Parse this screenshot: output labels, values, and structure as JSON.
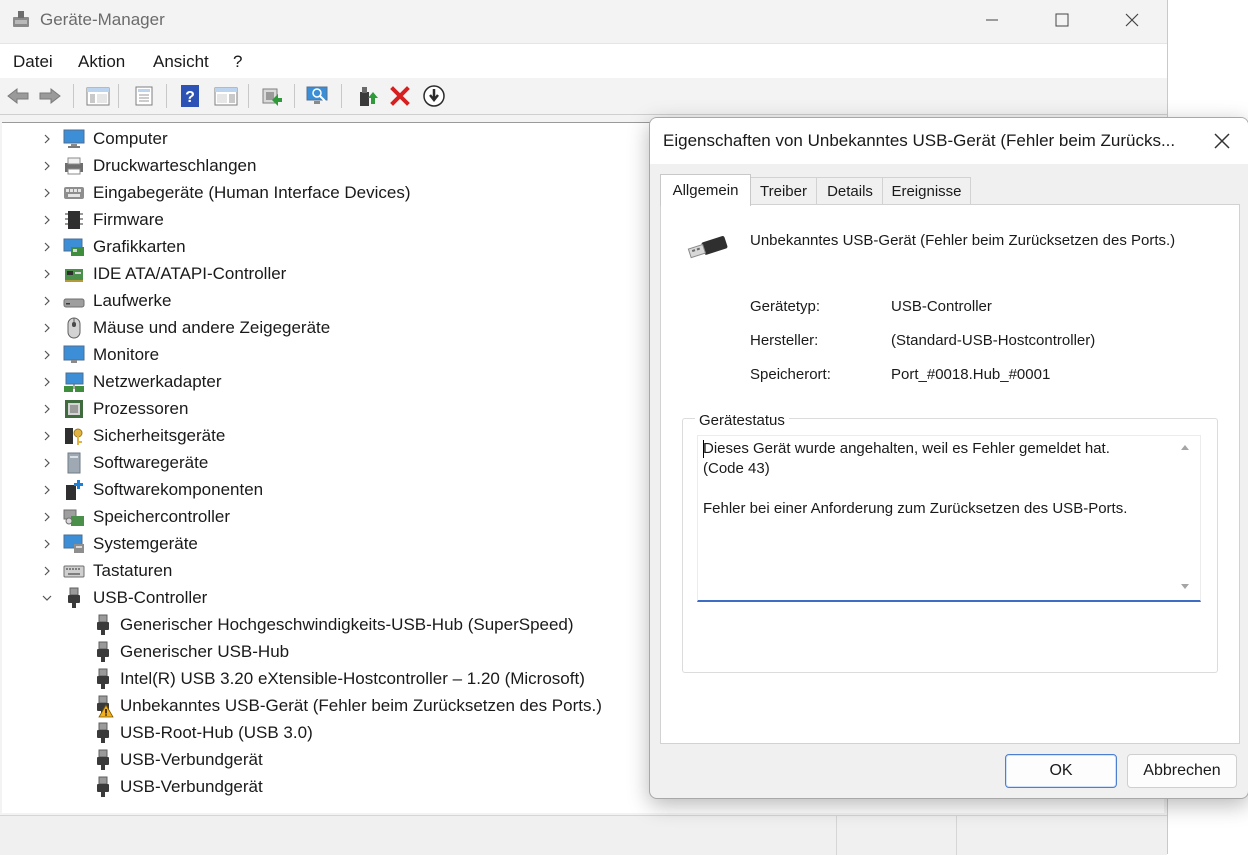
{
  "window": {
    "title": "Geräte-Manager"
  },
  "menu": [
    "Datei",
    "Aktion",
    "Ansicht",
    "?"
  ],
  "toolbar_icons": [
    "back-arrow-icon",
    "forward-arrow-icon",
    "show-hide-console-tree-icon",
    "properties-icon",
    "help-icon",
    "action-pane-icon",
    "update-driver-icon",
    "scan-hardware-icon",
    "enable-device-icon",
    "uninstall-device-icon",
    "disable-device-icon"
  ],
  "tree": {
    "categories": [
      {
        "label": "Computer",
        "icon": "computer-icon"
      },
      {
        "label": "Druckwarteschlangen",
        "icon": "printer-icon"
      },
      {
        "label": "Eingabegeräte (Human Interface Devices)",
        "icon": "hid-icon"
      },
      {
        "label": "Firmware",
        "icon": "firmware-icon"
      },
      {
        "label": "Grafikkarten",
        "icon": "display-adapter-icon"
      },
      {
        "label": "IDE ATA/ATAPI-Controller",
        "icon": "ide-controller-icon"
      },
      {
        "label": "Laufwerke",
        "icon": "disk-drive-icon"
      },
      {
        "label": "Mäuse und andere Zeigegeräte",
        "icon": "mouse-icon"
      },
      {
        "label": "Monitore",
        "icon": "monitor-icon"
      },
      {
        "label": "Netzwerkadapter",
        "icon": "network-adapter-icon"
      },
      {
        "label": "Prozessoren",
        "icon": "processor-icon"
      },
      {
        "label": "Sicherheitsgeräte",
        "icon": "security-device-icon"
      },
      {
        "label": "Softwaregeräte",
        "icon": "software-device-icon"
      },
      {
        "label": "Softwarekomponenten",
        "icon": "software-component-icon"
      },
      {
        "label": "Speichercontroller",
        "icon": "storage-controller-icon"
      },
      {
        "label": "Systemgeräte",
        "icon": "system-device-icon"
      },
      {
        "label": "Tastaturen",
        "icon": "keyboard-icon"
      }
    ],
    "usb_category": "USB-Controller",
    "usb_devices": [
      {
        "label": "Generischer Hochgeschwindigkeits-USB-Hub (SuperSpeed)",
        "warning": false
      },
      {
        "label": "Generischer USB-Hub",
        "warning": false
      },
      {
        "label": "Intel(R) USB 3.20 eXtensible-Hostcontroller – 1.20 (Microsoft)",
        "warning": false
      },
      {
        "label": "Unbekanntes USB-Gerät (Fehler beim Zurücksetzen des Ports.)",
        "warning": true
      },
      {
        "label": "USB-Root-Hub (USB 3.0)",
        "warning": false
      },
      {
        "label": "USB-Verbundgerät",
        "warning": false
      },
      {
        "label": "USB-Verbundgerät",
        "warning": false
      }
    ]
  },
  "dialog": {
    "title": "Eigenschaften von Unbekanntes USB-Gerät (Fehler beim Zurücks...",
    "tabs": [
      "Allgemein",
      "Treiber",
      "Details",
      "Ereignisse"
    ],
    "active_tab": "Allgemein",
    "device_name": "Unbekanntes USB-Gerät (Fehler beim Zurücksetzen des Ports.)",
    "info": [
      {
        "label": "Gerätetyp:",
        "value": "USB-Controller"
      },
      {
        "label": "Hersteller:",
        "value": "(Standard-USB-Hostcontroller)"
      },
      {
        "label": "Speicherort:",
        "value": "Port_#0018.Hub_#0001"
      }
    ],
    "status_label": "Gerätestatus",
    "status_text": "Dieses Gerät wurde angehalten, weil es Fehler gemeldet hat.\n(Code 43)\n\nFehler bei einer Anforderung zum Zurücksetzen des USB-Ports.",
    "ok_label": "OK",
    "cancel_label": "Abbrechen"
  },
  "colors": {
    "accent": "#3b6ec4",
    "warning": "#f2b01e",
    "error": "#d61f1f"
  }
}
